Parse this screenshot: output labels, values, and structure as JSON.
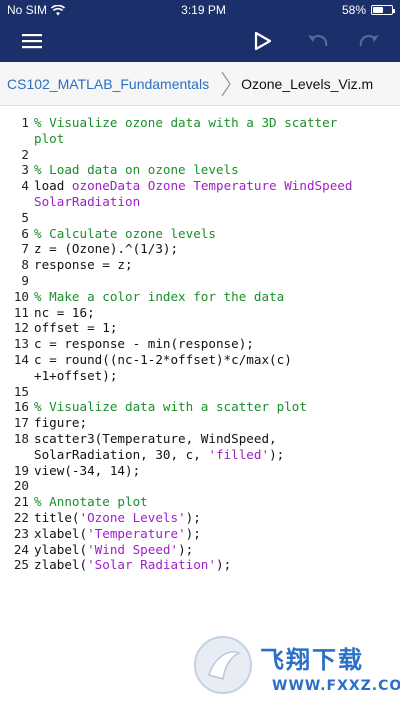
{
  "status_bar": {
    "carrier": "No SIM",
    "time": "3:19 PM",
    "battery": "58%",
    "battery_level": 0.58
  },
  "toolbar": {
    "menu_icon": "hamburger-menu-icon",
    "run_icon": "play-icon",
    "undo_icon": "undo-icon",
    "redo_icon": "redo-icon"
  },
  "breadcrumb": {
    "parent": "CS102_MATLAB_Fundamentals",
    "current": "Ozone_Levels_Viz.m"
  },
  "editor": {
    "lines": [
      {
        "num": "1",
        "segments": [
          {
            "t": "comment",
            "text": "% Visualize ozone data with a 3D scatter"
          }
        ]
      },
      {
        "num": "",
        "segments": [
          {
            "t": "comment",
            "text": "plot"
          }
        ]
      },
      {
        "num": "2",
        "segments": []
      },
      {
        "num": "3",
        "segments": [
          {
            "t": "comment",
            "text": "% Load data on ozone levels"
          }
        ]
      },
      {
        "num": "4",
        "segments": [
          {
            "t": "plain",
            "text": "load "
          },
          {
            "t": "string",
            "text": "ozoneData Ozone Temperature WindSpeed"
          }
        ]
      },
      {
        "num": "",
        "segments": [
          {
            "t": "string",
            "text": "SolarRadiation"
          }
        ]
      },
      {
        "num": "5",
        "segments": []
      },
      {
        "num": "6",
        "segments": [
          {
            "t": "comment",
            "text": "% Calculate ozone levels"
          }
        ]
      },
      {
        "num": "7",
        "segments": [
          {
            "t": "plain",
            "text": "z = (Ozone).^(1/3);"
          }
        ]
      },
      {
        "num": "8",
        "segments": [
          {
            "t": "plain",
            "text": "response = z;"
          }
        ]
      },
      {
        "num": "9",
        "segments": []
      },
      {
        "num": "10",
        "segments": [
          {
            "t": "comment",
            "text": "% Make a color index for the data"
          }
        ]
      },
      {
        "num": "11",
        "segments": [
          {
            "t": "plain",
            "text": "nc = 16;"
          }
        ]
      },
      {
        "num": "12",
        "segments": [
          {
            "t": "plain",
            "text": "offset = 1;"
          }
        ]
      },
      {
        "num": "13",
        "segments": [
          {
            "t": "plain",
            "text": "c = response - min(response);"
          }
        ]
      },
      {
        "num": "14",
        "segments": [
          {
            "t": "plain",
            "text": "c = round((nc-1-2*offset)*c/max(c)"
          }
        ]
      },
      {
        "num": "",
        "segments": [
          {
            "t": "plain",
            "text": "+1+offset);"
          }
        ]
      },
      {
        "num": "15",
        "segments": []
      },
      {
        "num": "16",
        "segments": [
          {
            "t": "comment",
            "text": "% Visualize data with a scatter plot"
          }
        ]
      },
      {
        "num": "17",
        "segments": [
          {
            "t": "plain",
            "text": "figure;"
          }
        ]
      },
      {
        "num": "18",
        "segments": [
          {
            "t": "plain",
            "text": "scatter3(Temperature, WindSpeed,"
          }
        ]
      },
      {
        "num": "",
        "segments": [
          {
            "t": "plain",
            "text": "SolarRadiation, 30, c, "
          },
          {
            "t": "string",
            "text": "'filled'"
          },
          {
            "t": "plain",
            "text": ");"
          }
        ]
      },
      {
        "num": "19",
        "segments": [
          {
            "t": "plain",
            "text": "view(-34, 14);"
          }
        ]
      },
      {
        "num": "20",
        "segments": []
      },
      {
        "num": "21",
        "segments": [
          {
            "t": "comment",
            "text": "% Annotate plot"
          }
        ]
      },
      {
        "num": "22",
        "segments": [
          {
            "t": "plain",
            "text": "title("
          },
          {
            "t": "string",
            "text": "'Ozone Levels'"
          },
          {
            "t": "plain",
            "text": ");"
          }
        ]
      },
      {
        "num": "23",
        "segments": [
          {
            "t": "plain",
            "text": "xlabel("
          },
          {
            "t": "string",
            "text": "'Temperature'"
          },
          {
            "t": "plain",
            "text": ");"
          }
        ]
      },
      {
        "num": "24",
        "segments": [
          {
            "t": "plain",
            "text": "ylabel("
          },
          {
            "t": "string",
            "text": "'Wind Speed'"
          },
          {
            "t": "plain",
            "text": ");"
          }
        ]
      },
      {
        "num": "25",
        "segments": [
          {
            "t": "plain",
            "text": "zlabel("
          },
          {
            "t": "string",
            "text": "'Solar Radiation'"
          },
          {
            "t": "plain",
            "text": ");"
          }
        ]
      }
    ]
  },
  "watermark": {
    "title": "飞翔下载",
    "url": "WWW.FXXZ.COM"
  },
  "colors": {
    "header_bg": "#1b2f6b",
    "link": "#2d6fc0",
    "comment": "#1a8f2a",
    "string": "#a020c8"
  }
}
